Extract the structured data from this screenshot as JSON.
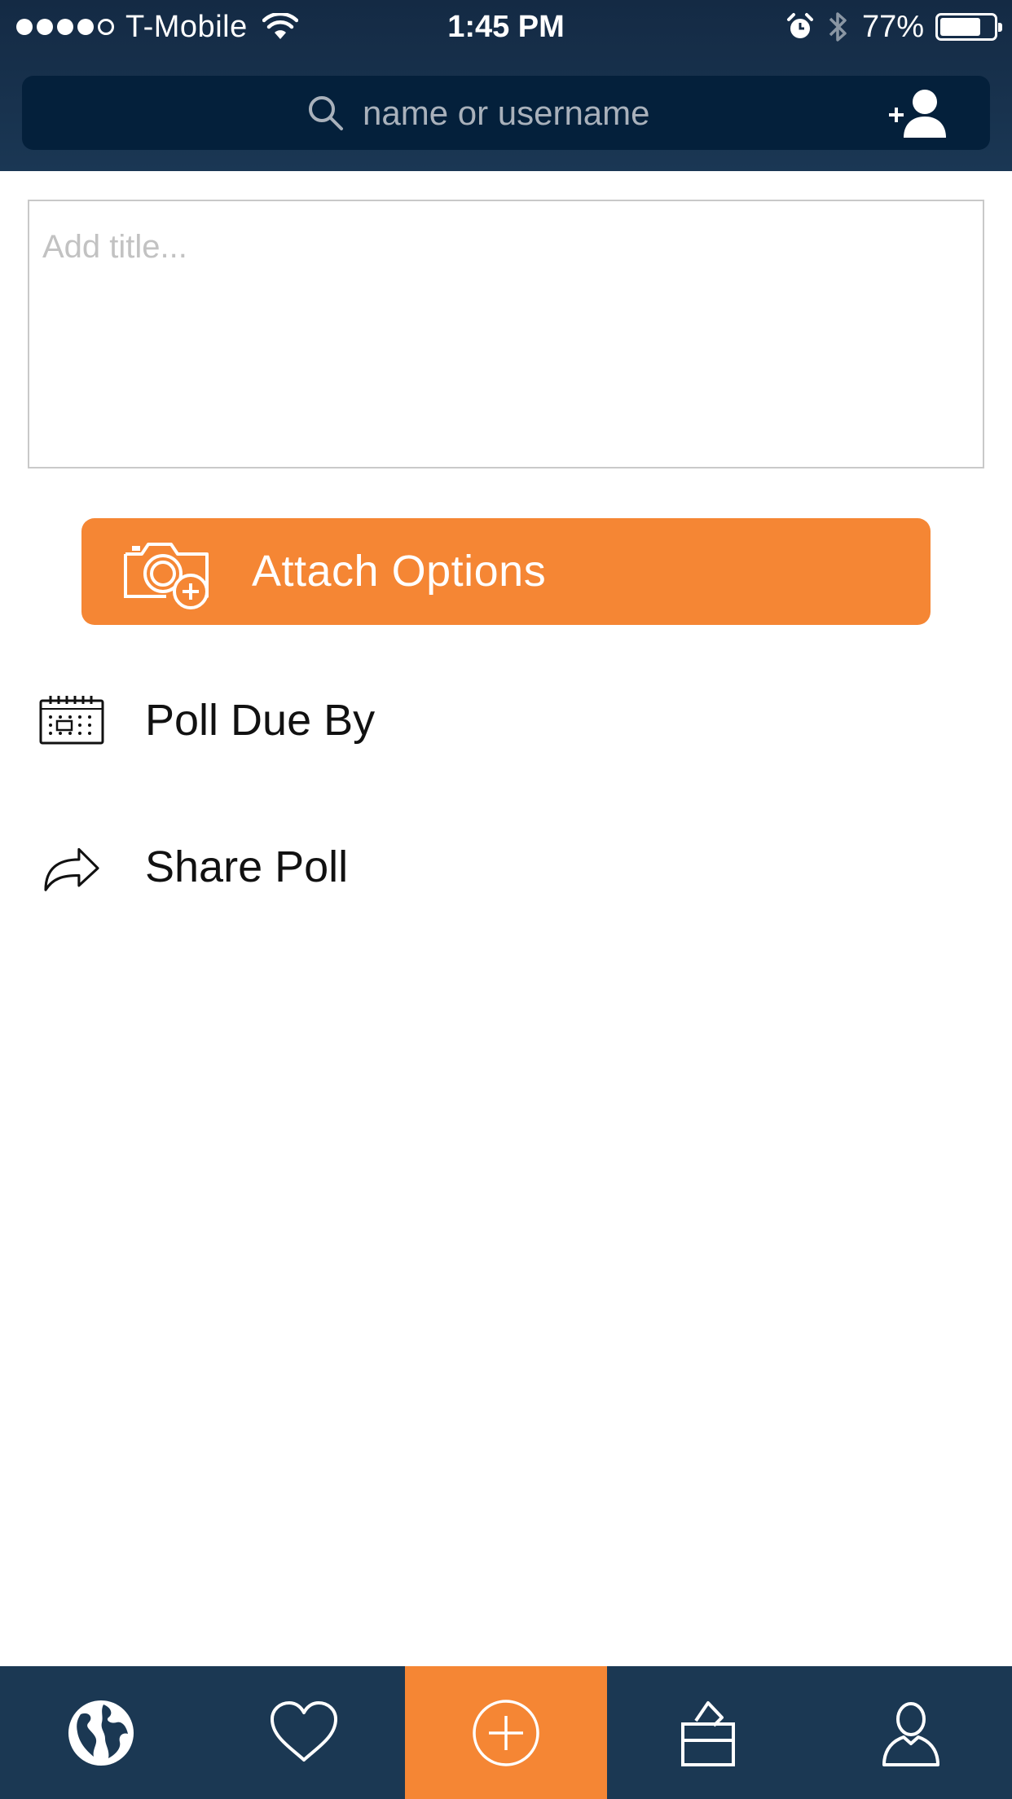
{
  "status_bar": {
    "carrier": "T-Mobile",
    "time": "1:45 PM",
    "battery": "77%",
    "battery_level": 0.77,
    "signal_bars_filled": 4,
    "signal_bars_total": 5,
    "icons": [
      "wifi-icon",
      "alarm-icon",
      "bluetooth-icon",
      "battery-icon"
    ]
  },
  "search": {
    "placeholder": "name or username",
    "icon": "search-icon",
    "add_user_icon": "add-user-icon"
  },
  "form": {
    "title_placeholder": "Add title...",
    "attach_label": "Attach Options",
    "attach_icon": "camera-add-icon"
  },
  "rows": [
    {
      "label": "Poll Due By",
      "icon": "calendar-icon"
    },
    {
      "label": "Share Poll",
      "icon": "share-arrow-icon"
    }
  ],
  "tab_bar": {
    "active_index": 2,
    "tabs": [
      {
        "icon": "globe-icon"
      },
      {
        "icon": "heart-icon"
      },
      {
        "icon": "plus-circle-icon"
      },
      {
        "icon": "ballot-box-icon"
      },
      {
        "icon": "profile-icon"
      }
    ]
  },
  "colors": {
    "header_bg": "#142a44",
    "search_bg": "#04203b",
    "accent": "#f58634",
    "tab_bar_bg": "#1b3853"
  }
}
